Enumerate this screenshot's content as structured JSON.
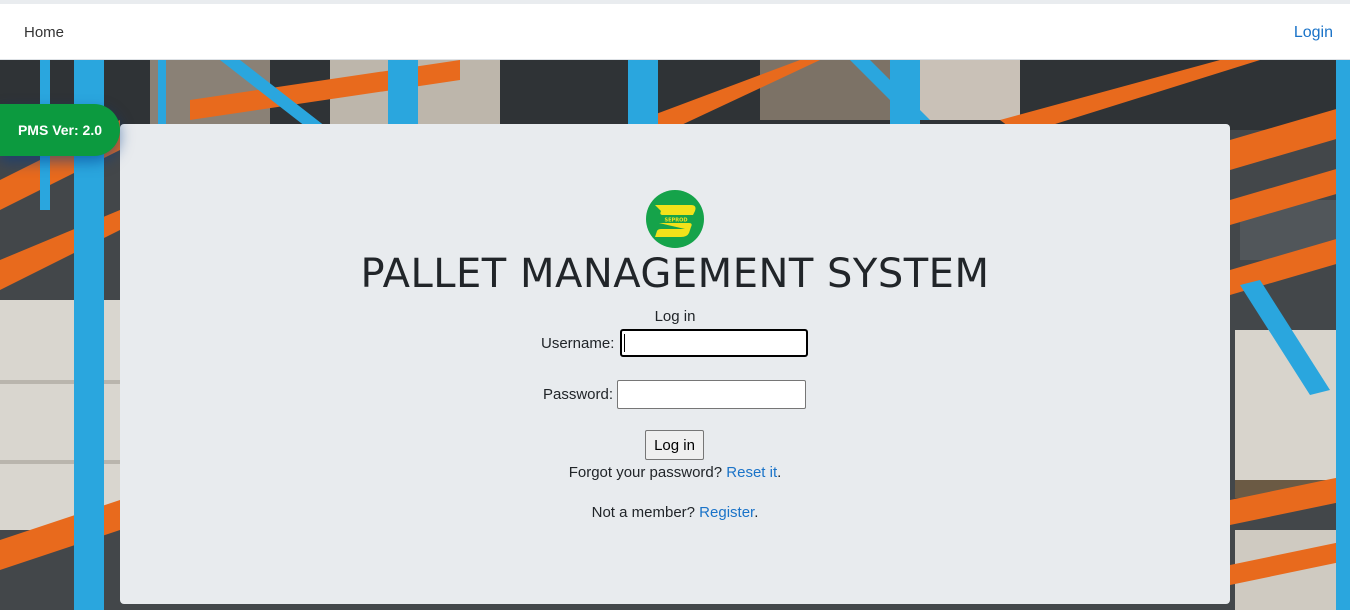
{
  "nav": {
    "home_label": "Home",
    "login_label": "Login"
  },
  "badge": {
    "version_text": "PMS Ver: 2.0"
  },
  "logo": {
    "icon": "seprod-logo-icon",
    "text": "SEPROD"
  },
  "card": {
    "title": "PALLET MANAGEMENT SYSTEM",
    "form_heading": "Log in",
    "username_label": "Username:",
    "username_value": "",
    "password_label": "Password:",
    "password_value": "",
    "submit_label": "Log in",
    "forgot_text": "Forgot your password?",
    "reset_link": "Reset it",
    "member_text": "Not a member?",
    "register_link": "Register",
    "period": "."
  },
  "colors": {
    "badge_green": "#0c9a3f",
    "link_blue": "#1a73c8",
    "card_bg": "#e8ebee",
    "rack_blue": "#2aa6de",
    "beam_orange": "#e86a1d"
  }
}
